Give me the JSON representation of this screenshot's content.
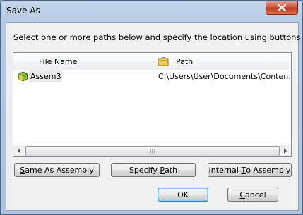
{
  "window": {
    "title": "Save As"
  },
  "instruction": "Select one or more paths below and specify the location using buttons",
  "list": {
    "columns": [
      "File Name",
      "Path"
    ],
    "rows": [
      {
        "name": "Assem3",
        "path": "C:\\Users\\User\\Documents\\Conten..."
      }
    ]
  },
  "buttons": {
    "same_as_assembly": {
      "accel": "S",
      "rest": "ame As Assembly"
    },
    "specify_path": {
      "pre": "Specify ",
      "accel": "P",
      "post": "ath"
    },
    "internal_to_assembly": {
      "pre": "Internal ",
      "accel": "T",
      "post": "o Assembly"
    },
    "ok": "OK",
    "cancel": {
      "accel": "C",
      "rest": "ancel"
    }
  },
  "icons": {
    "close": "close-icon",
    "folder": "folder-icon",
    "assembly": "assembly-icon"
  }
}
